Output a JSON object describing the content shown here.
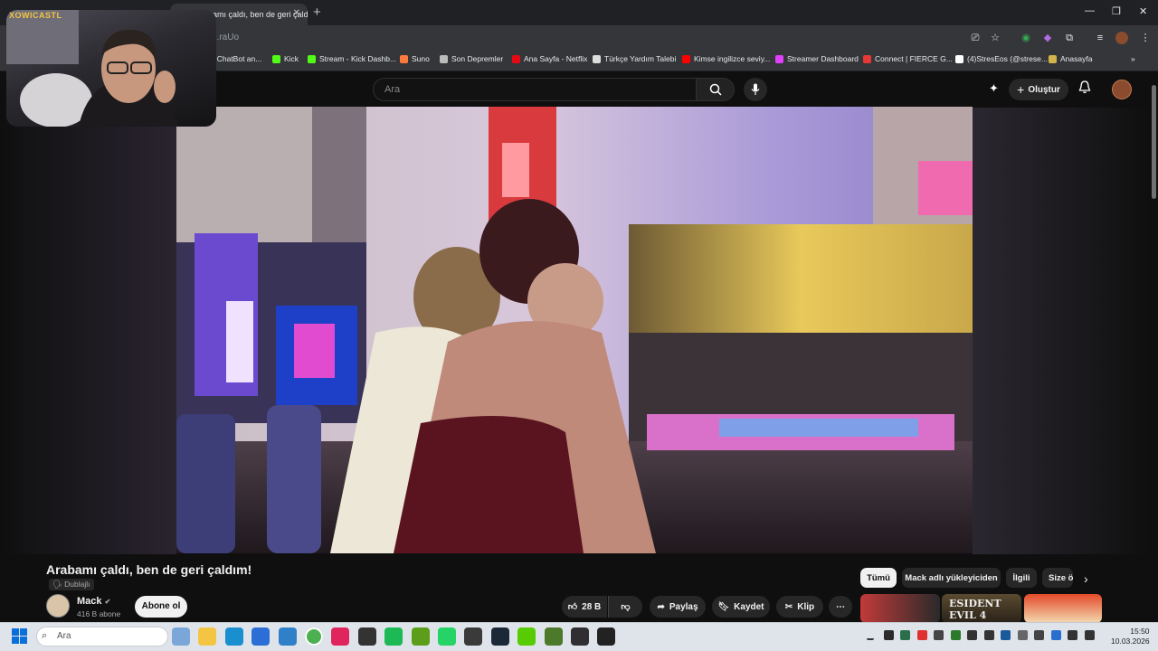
{
  "browser": {
    "tab_title": "Arabamı çaldı, ben de geri çaldı...",
    "url": "...raUo",
    "bookmarks": [
      {
        "label": "t ChatBot an...",
        "color": "#7b61ff"
      },
      {
        "label": "Kick",
        "color": "#53fc18"
      },
      {
        "label": "Stream - Kick Dashb...",
        "color": "#53fc18"
      },
      {
        "label": "Suno",
        "color": "#ff7a3d"
      },
      {
        "label": "Son Depremler",
        "color": "#bbbbbb"
      },
      {
        "label": "Ana Sayfa - Netflix",
        "color": "#e50914"
      },
      {
        "label": "Türkçe Yardım Talebi",
        "color": "#dddddd"
      },
      {
        "label": "Kimse ingilizce seviy...",
        "color": "#ff0000"
      },
      {
        "label": "Streamer Dashboard",
        "color": "#e040fb"
      },
      {
        "label": "Connect | FIERCE G...",
        "color": "#e53935"
      },
      {
        "label": "(4)StresEos (@strese...",
        "color": "#ffffff"
      },
      {
        "label": "Anasayfa",
        "color": "#d4b24c"
      }
    ]
  },
  "webcam": {
    "label": "XOWICASTL"
  },
  "youtube": {
    "search_placeholder": "Ara",
    "create_label": "Oluştur",
    "video": {
      "title": "Arabamı çaldı, ben de geri çaldım!",
      "dubbed": "Dublajlı",
      "channel": "Mack",
      "subscribers": "416 B abone",
      "subscribe": "Abone ol",
      "likes": "28 B",
      "share": "Paylaş",
      "save": "Kaydet",
      "clip": "Klip"
    },
    "chips": [
      "Tümü",
      "Mack adlı yükleyiciden",
      "İlgili",
      "Size ö"
    ]
  },
  "taskbar": {
    "search_placeholder": "Ara",
    "time": "15:50",
    "date": "10.03.2026"
  }
}
